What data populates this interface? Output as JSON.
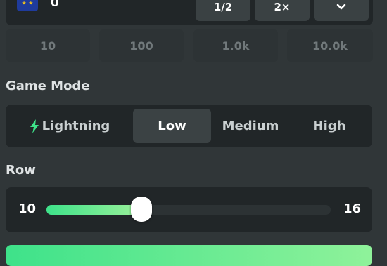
{
  "bet": {
    "value": "0",
    "currency_icon": "eu-flag-icon",
    "half_label": "1/2",
    "double_label": "2×"
  },
  "quick_amounts": [
    "10",
    "100",
    "1.0k",
    "10.0k"
  ],
  "game_mode": {
    "label": "Game Mode",
    "options": [
      "Lightning",
      "Low",
      "Medium",
      "High"
    ],
    "selected": "Low"
  },
  "row": {
    "label": "Row",
    "min": "10",
    "max": "16",
    "value": 12
  },
  "colors": {
    "background": "#303638",
    "panel": "#212628",
    "accent_green": "#3ee28a",
    "selected_tab": "#3b4244"
  }
}
